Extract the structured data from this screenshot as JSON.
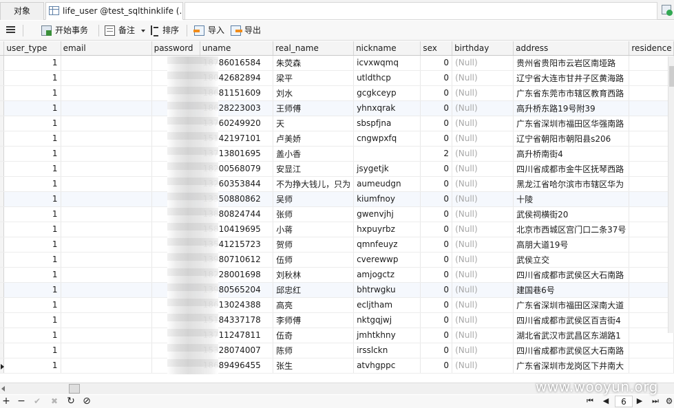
{
  "tabs": [
    {
      "label": "对象"
    },
    {
      "label": "life_user @test_sqlthinklife (..."
    }
  ],
  "toolbar": {
    "begin_transaction": "开始事务",
    "note": "备注",
    "sort": "排序",
    "import": "导入",
    "export": "导出"
  },
  "columns": [
    "user_type",
    "email",
    "password",
    "uname",
    "real_name",
    "nickname",
    "sex",
    "birthday",
    "address",
    "residence"
  ],
  "null_text": "(Null)",
  "rows": [
    {
      "user_type": "1",
      "uname": "18786016584",
      "real_name": "朱荧森",
      "nickname": "icvxwqmq",
      "sex": "0",
      "address": "贵州省贵阳市云岩区南垭路"
    },
    {
      "user_type": "1",
      "uname": "18042682894",
      "real_name": "梁平",
      "nickname": "utldthcp",
      "sex": "0",
      "address": "辽宁省大连市甘井子区黄海路"
    },
    {
      "user_type": "1",
      "uname": "18681151609",
      "real_name": "刘水",
      "nickname": "gcgkceyp",
      "sex": "0",
      "address": "广东省东莞市市辖区教育西路"
    },
    {
      "user_type": "1",
      "uname": "18628223003",
      "real_name": "王师傅",
      "nickname": "yhnxqrak",
      "sex": "0",
      "address": "高升桥东路19号附39"
    },
    {
      "user_type": "1",
      "uname": "13760249920",
      "real_name": "天",
      "nickname": "sbspfjna",
      "sex": "0",
      "address": "广东省深圳市福田区华强南路"
    },
    {
      "user_type": "1",
      "uname": "15142197101",
      "real_name": "卢美娇",
      "nickname": "cngwpxfq",
      "sex": "0",
      "address": "辽宁省朝阳市朝阳县s206"
    },
    {
      "user_type": "1",
      "uname": "13713801695",
      "real_name": "盖小香",
      "nickname": "",
      "sex": "2",
      "address": "高升桥南街4"
    },
    {
      "user_type": "1",
      "uname": "18200568079",
      "real_name": "安显江",
      "nickname": "jsygetjk",
      "sex": "0",
      "address": "四川省成都市金牛区抚琴西路"
    },
    {
      "user_type": "1",
      "uname": "13260353844",
      "real_name": "不为挣大钱儿，只为",
      "nickname": "aumeudgn",
      "sex": "0",
      "address": "黑龙江省哈尔滨市市辖区华为"
    },
    {
      "user_type": "1",
      "uname": "13350880862",
      "real_name": "吴师",
      "nickname": "kiumfnoy",
      "sex": "0",
      "address": "十陵"
    },
    {
      "user_type": "1",
      "uname": "13880824744",
      "real_name": "张师",
      "nickname": "gwenvjhj",
      "sex": "0",
      "address": "武侯祠横街20"
    },
    {
      "user_type": "1",
      "uname": "15810419695",
      "real_name": "小蒋",
      "nickname": "hxpuyrbz",
      "sex": "0",
      "address": "北京市西城区宫门口二条37号"
    },
    {
      "user_type": "1",
      "uname": "13541215723",
      "real_name": "贺师",
      "nickname": "qmnfeuyz",
      "sex": "0",
      "address": "高朋大道19号"
    },
    {
      "user_type": "1",
      "uname": "13980710612",
      "real_name": "伍师",
      "nickname": "cverewwp",
      "sex": "0",
      "address": "武侯立交"
    },
    {
      "user_type": "1",
      "uname": "18228001698",
      "real_name": "刘秋林",
      "nickname": "amjogctz",
      "sex": "0",
      "address": "四川省成都市武侯区大石南路"
    },
    {
      "user_type": "1",
      "uname": "13980565204",
      "real_name": "邱忠红",
      "nickname": "bhtrwgku",
      "sex": "0",
      "address": "建国巷6号"
    },
    {
      "user_type": "1",
      "uname": "18613024388",
      "real_name": "高亮",
      "nickname": "ecljtham",
      "sex": "0",
      "address": "广东省深圳市福田区深南大道"
    },
    {
      "user_type": "1",
      "uname": "15184337178",
      "real_name": "李师傅",
      "nickname": "nktgqjwj",
      "sex": "0",
      "address": "四川省成都市武侯区百吉街4"
    },
    {
      "user_type": "1",
      "uname": "13711247811",
      "real_name": "伍奇",
      "nickname": "jmhtkhny",
      "sex": "0",
      "address": "湖北省武汉市武昌区东湖路1"
    },
    {
      "user_type": "1",
      "uname": "15328074007",
      "real_name": "陈师",
      "nickname": "irsslckn",
      "sex": "0",
      "address": "四川省成都市武侯区大石南路"
    },
    {
      "user_type": "1",
      "uname": "18689496455",
      "real_name": "张生",
      "nickname": "atvhgppc",
      "sex": "0",
      "address": "广东省深圳市龙岗区下井南大"
    }
  ],
  "statusbar": {
    "add": "+",
    "remove": "−",
    "apply": "✔",
    "discard": "✖",
    "refresh": "↻",
    "stop": "⊘",
    "page": "6"
  },
  "watermark": "www.wooyun.org",
  "icons": [
    "table-icon",
    "menu-icon",
    "transaction-icon",
    "note-icon",
    "sort-icon",
    "import-icon",
    "export-icon",
    "add-record-icon"
  ]
}
